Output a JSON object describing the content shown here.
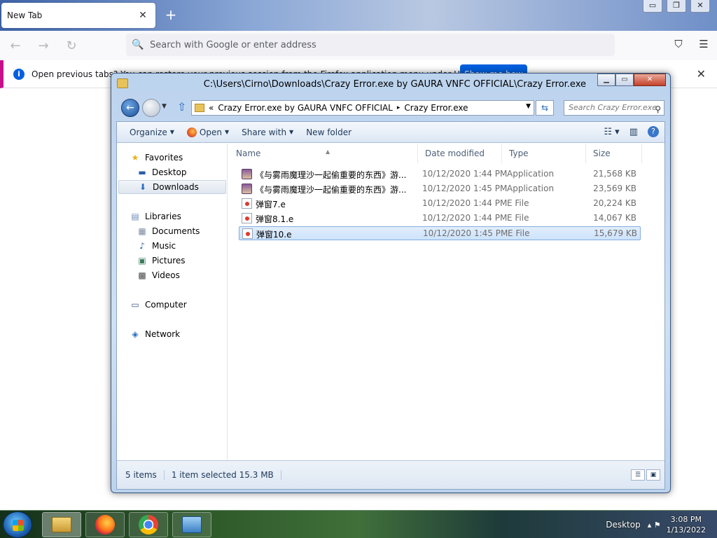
{
  "browser": {
    "tab_title": "New Tab",
    "tab_close": "✕",
    "new_tab": "+",
    "window_controls": [
      "▭",
      "❐",
      "✕"
    ],
    "nav": {
      "back": "←",
      "forward": "→",
      "reload": "↻"
    },
    "url_placeholder": "Search with Google or enter address",
    "search_icon": "🔍",
    "pocket_icon": "⛉",
    "menu_icon": "☰",
    "notification": {
      "text": "Open previous tabs? You can restore your previous session from the Firefox application menu under History.",
      "button": "Show me how",
      "close": "✕"
    }
  },
  "explorer": {
    "title": "C:\\Users\\Cirno\\Downloads\\Crazy Error.exe by GAURA VNFC OFFICIAL\\Crazy Error.exe",
    "window_controls": {
      "minimize": "▁",
      "maximize": "▭",
      "close": "✕"
    },
    "address": {
      "prefix": "«",
      "segments": [
        "Crazy Error.exe by GAURA VNFC OFFICIAL",
        "Crazy Error.exe"
      ],
      "separator": "▸"
    },
    "search_placeholder": "Search Crazy Error.exe",
    "toolbar": {
      "organize": "Organize",
      "open": "Open",
      "share_with": "Share with",
      "new_folder": "New folder"
    },
    "nav_pane": {
      "favorites": "Favorites",
      "desktop": "Desktop",
      "downloads": "Downloads",
      "libraries": "Libraries",
      "documents": "Documents",
      "music": "Music",
      "pictures": "Pictures",
      "videos": "Videos",
      "computer": "Computer",
      "network": "Network"
    },
    "columns": {
      "name": "Name",
      "date": "Date modified",
      "type": "Type",
      "size": "Size"
    },
    "files": [
      {
        "name": "《与雾雨魔理沙一起偷重要的东西》游...",
        "date": "10/12/2020 1:44 PM",
        "type": "Application",
        "size": "21,568 KB",
        "icon": "app"
      },
      {
        "name": "《与雾雨魔理沙一起偷重要的东西》游...",
        "date": "10/12/2020 1:45 PM",
        "type": "Application",
        "size": "23,569 KB",
        "icon": "app"
      },
      {
        "name": "弹窗7.e",
        "date": "10/12/2020 1:44 PM",
        "type": "E File",
        "size": "20,224 KB",
        "icon": "e"
      },
      {
        "name": "弹窗8.1.e",
        "date": "10/12/2020 1:44 PM",
        "type": "E File",
        "size": "14,067 KB",
        "icon": "e"
      },
      {
        "name": "弹窗10.e",
        "date": "10/12/2020 1:45 PM",
        "type": "E File",
        "size": "15,679 KB",
        "icon": "e",
        "selected": true
      }
    ],
    "status": {
      "count": "5 items",
      "selection": "1 item selected  15.3 MB"
    }
  },
  "taskbar": {
    "desktop_label": "Desktop",
    "time": "3:08 PM",
    "date": "1/13/2022"
  }
}
